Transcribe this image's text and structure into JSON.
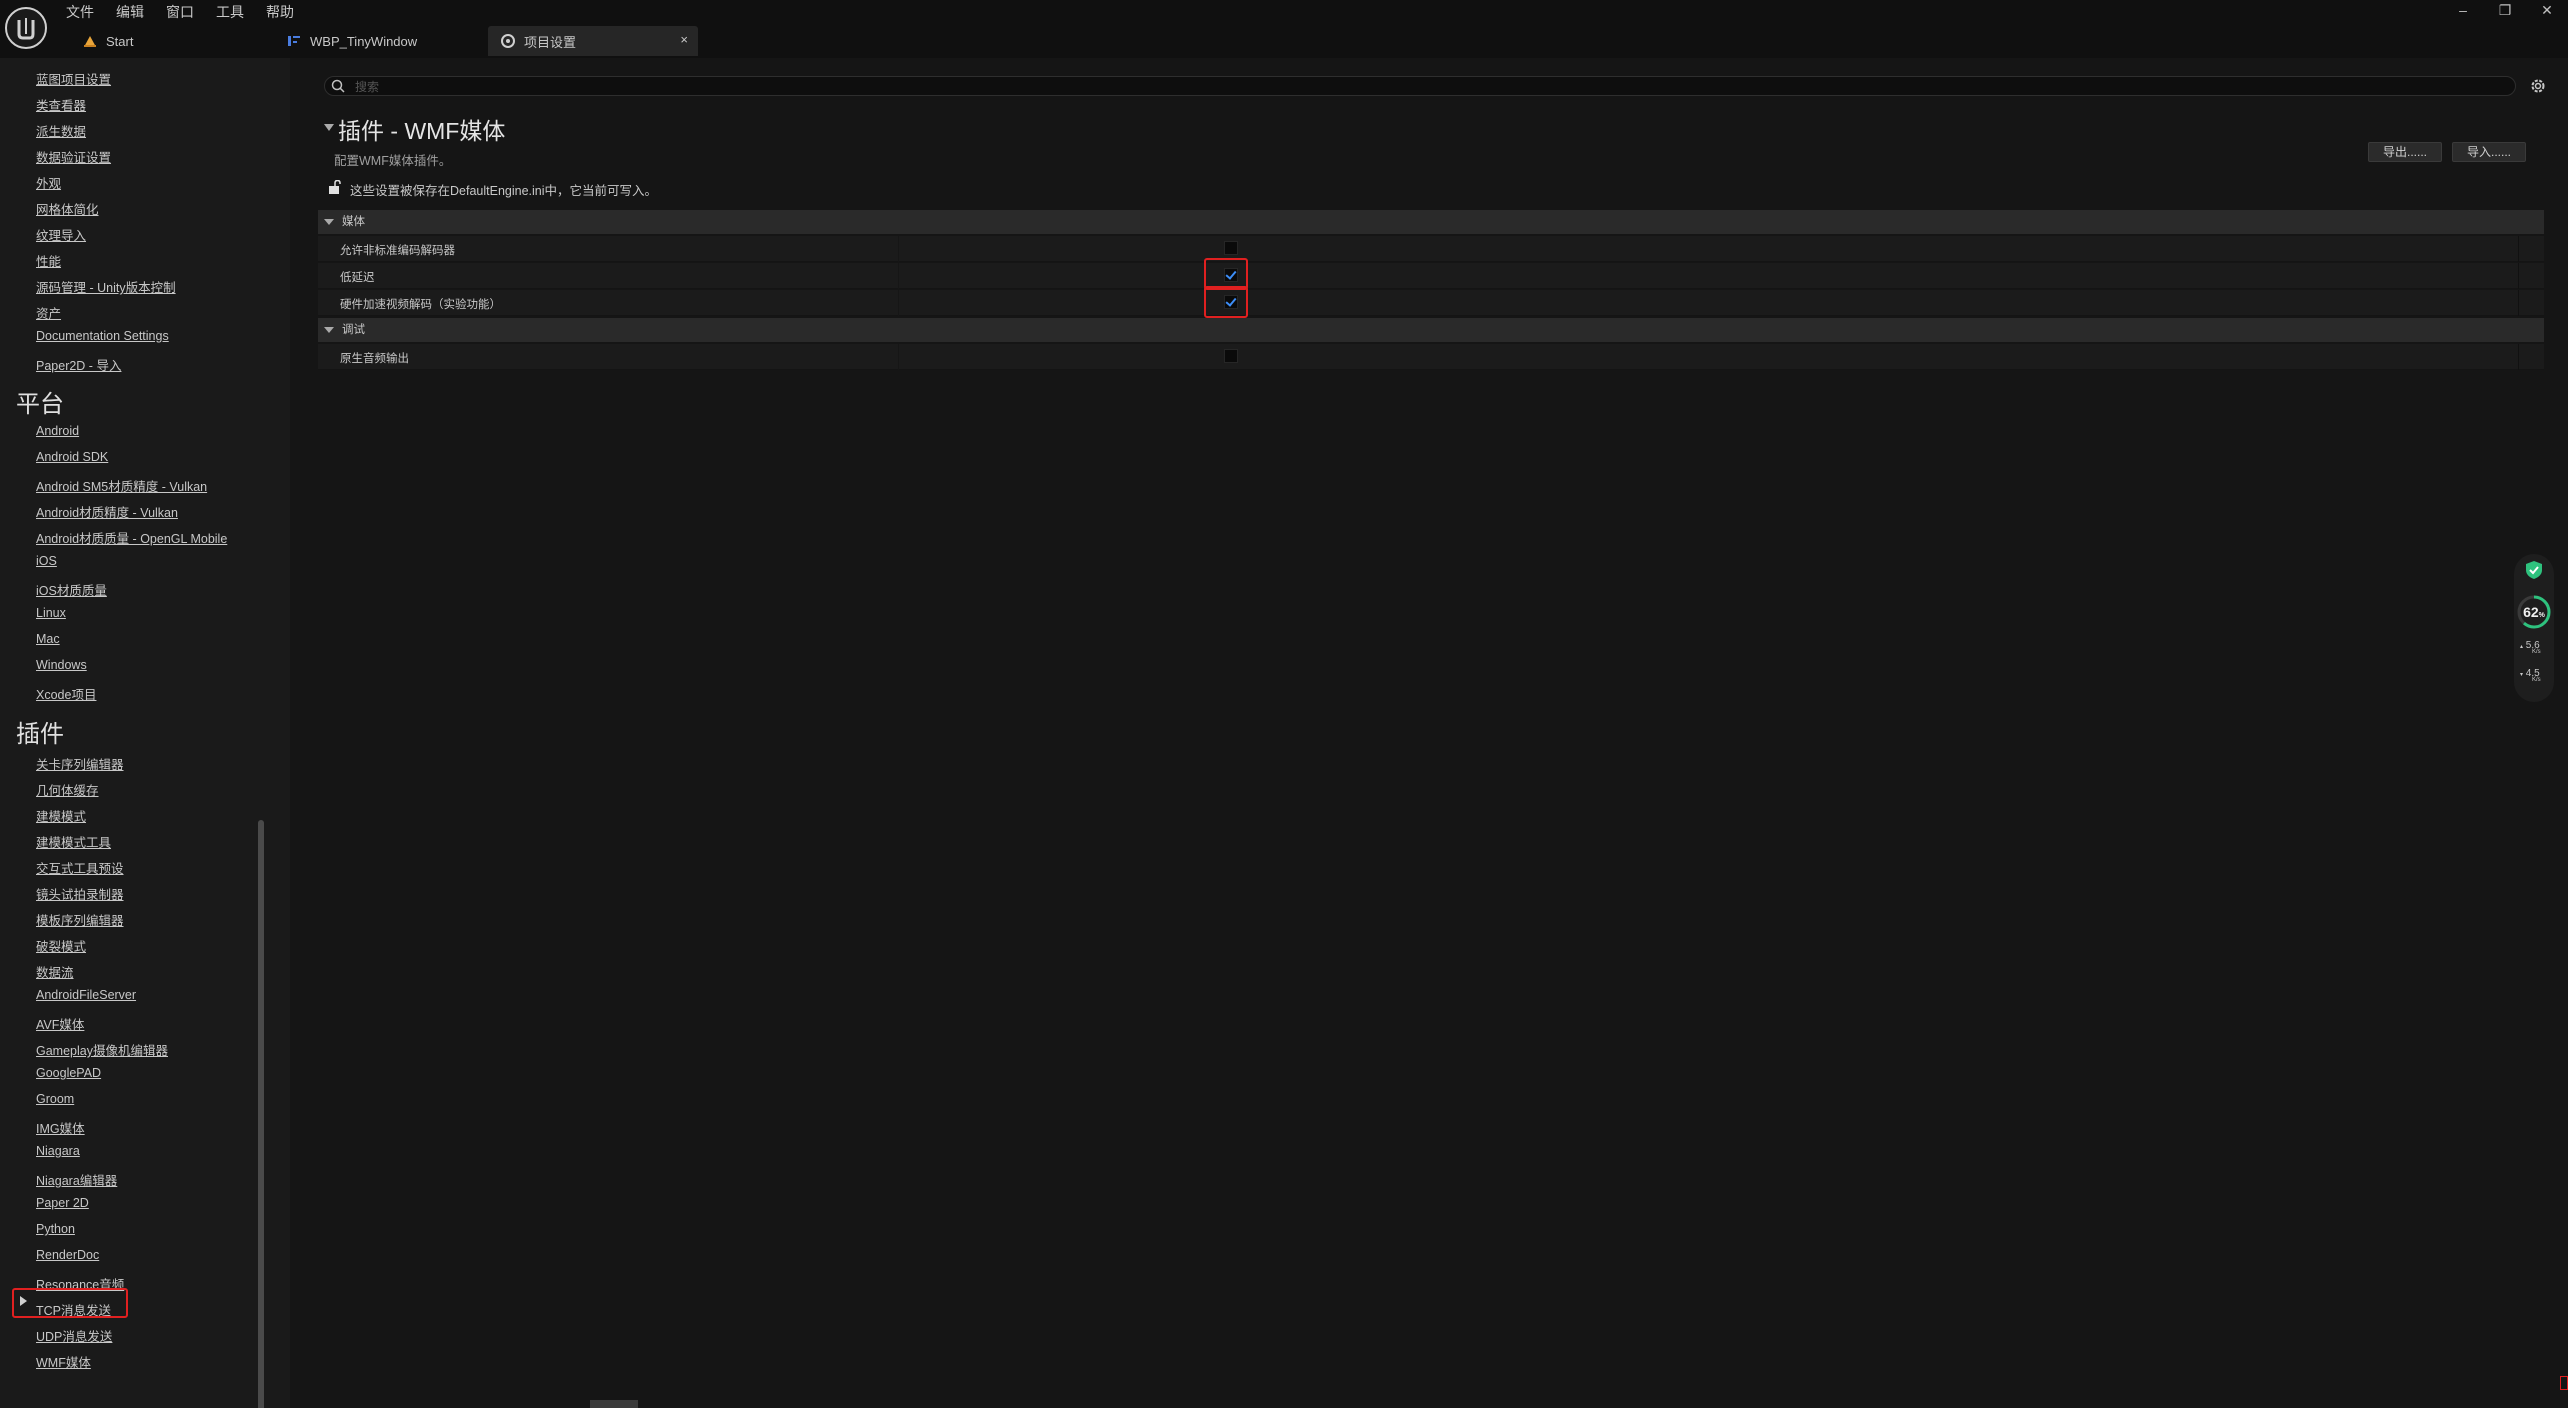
{
  "menu": [
    "文件",
    "编辑",
    "窗口",
    "工具",
    "帮助"
  ],
  "tabs": {
    "start": "Start",
    "wbp": "WBP_TinyWindow",
    "settings": "项目设置",
    "close": "×"
  },
  "window_controls": {
    "minimize": "–",
    "restore": "❐",
    "close": "✕"
  },
  "sidebar": {
    "top_links": [
      "蓝图项目设置",
      "类查看器",
      "派生数据",
      "数据验证设置",
      "外观",
      "网格体简化",
      "纹理导入",
      "性能",
      "源码管理 - Unity版本控制",
      "资产",
      "Documentation Settings",
      "Paper2D - 导入"
    ],
    "platform_header": "平台",
    "platform_links": [
      "Android",
      "Android SDK",
      "Android SM5材质精度 - Vulkan",
      "Android材质精度 - Vulkan",
      "Android材质质量 - OpenGL Mobile",
      "iOS",
      "iOS材质质量",
      "Linux",
      "Mac",
      "Windows",
      "Xcode项目"
    ],
    "plugins_header": "插件",
    "plugin_links": [
      "关卡序列编辑器",
      "几何体缓存",
      "建模模式",
      "建模模式工具",
      "交互式工具预设",
      "镜头试拍录制器",
      "模板序列编辑器",
      "破裂模式",
      "数据流",
      "AndroidFileServer",
      "AVF媒体",
      "Gameplay摄像机编辑器",
      "GooglePAD",
      "Groom",
      "IMG媒体",
      "Niagara",
      "Niagara编辑器",
      "Paper 2D",
      "Python",
      "RenderDoc",
      "Resonance音频",
      "TCP消息发送",
      "UDP消息发送",
      "WMF媒体"
    ]
  },
  "main": {
    "search_placeholder": "搜索",
    "title": "插件 - WMF媒体",
    "description": "配置WMF媒体插件。",
    "export_label": "导出......",
    "import_label": "导入......",
    "config_note": "这些设置被保存在DefaultEngine.ini中，它当前可写入。",
    "categories": [
      {
        "name": "媒体",
        "properties": [
          {
            "label": "允许非标准编码解码器",
            "checked": false
          },
          {
            "label": "低延迟",
            "checked": true
          },
          {
            "label": "硬件加速视频解码（实验功能）",
            "checked": true
          }
        ]
      },
      {
        "name": "调试",
        "properties": [
          {
            "label": "原生音频输出",
            "checked": false
          }
        ]
      }
    ]
  },
  "monitor": {
    "cpu_percent": "62",
    "cpu_unit": "%",
    "upload_value": "5.6",
    "upload_unit": "K/s",
    "download_value": "4.5",
    "download_unit": "K/s",
    "accent_color": "#2ec27e"
  }
}
